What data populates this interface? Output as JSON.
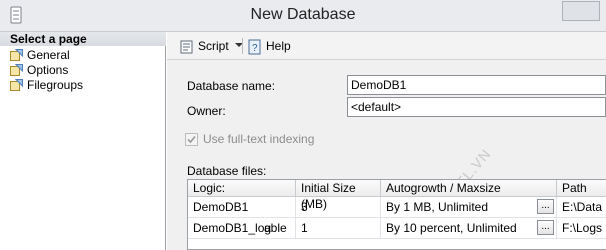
{
  "window": {
    "title": "New Database"
  },
  "left_pane": {
    "header": "Select a page",
    "items": [
      {
        "label": "General"
      },
      {
        "label": "Options"
      },
      {
        "label": "Filegroups"
      }
    ]
  },
  "toolbar": {
    "script_label": "Script",
    "help_label": "Help"
  },
  "form": {
    "database_name_label": "Database name:",
    "database_name_value": "DemoDB1",
    "owner_label": "Owner:",
    "owner_value": "<default>",
    "fulltext_label": "Use full-text indexing",
    "fulltext_checked": true,
    "fulltext_enabled": false,
    "files_label": "Database files:"
  },
  "watermark": "CTL.VN",
  "grid": {
    "headers": [
      "Logic:",
      "Initial Size (MB)",
      "Autogrowth / Maxsize",
      "Path"
    ],
    "rows": [
      {
        "logical": "DemoDB1",
        "extra": "",
        "size": "3",
        "growth": "By 1 MB, Unlimited",
        "path": "E:\\Data"
      },
      {
        "logical": "DemoDB1_log",
        "extra": "able",
        "size": "1",
        "growth": "By 10 percent, Unlimited",
        "path": "F:\\Logs"
      }
    ],
    "ellipsis_label": "..."
  }
}
